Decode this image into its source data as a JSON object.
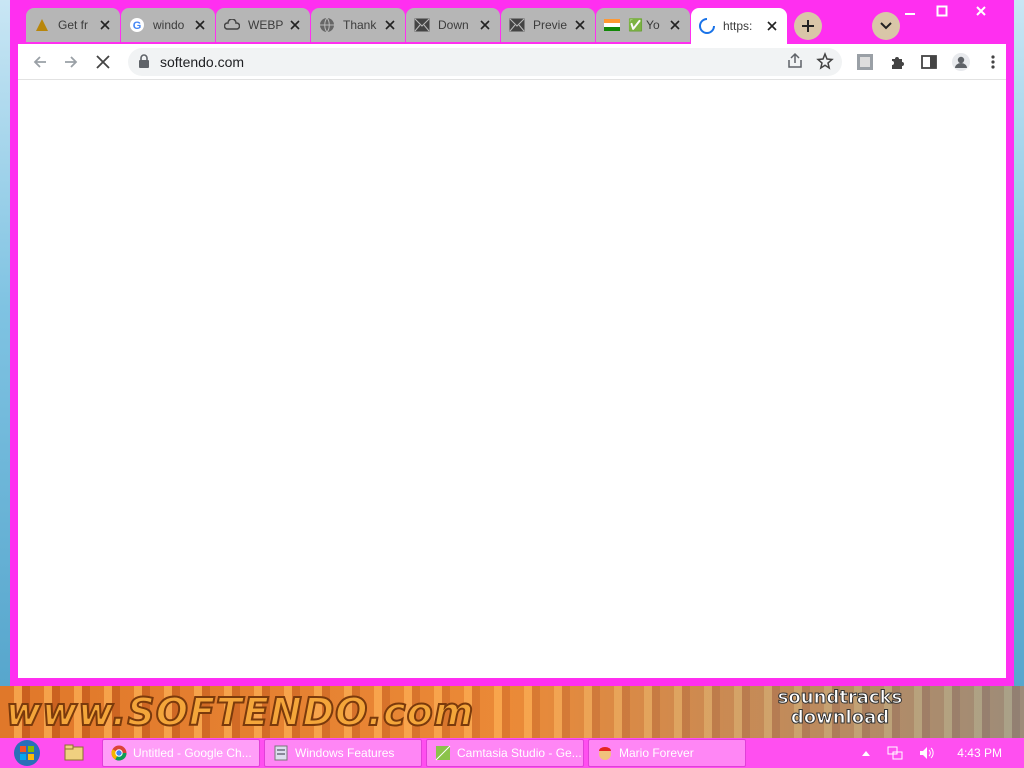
{
  "browser": {
    "tabs": [
      {
        "title": "Get fr",
        "icon": "warning-triangle-icon"
      },
      {
        "title": "windo",
        "icon": "google-icon"
      },
      {
        "title": "WEBP",
        "icon": "cloud-icon"
      },
      {
        "title": "Thank",
        "icon": "globe-icon"
      },
      {
        "title": "Down",
        "icon": "mail-icon"
      },
      {
        "title": "Previe",
        "icon": "mail-icon"
      },
      {
        "title": "✅ Yo",
        "icon": "india-flag-icon"
      },
      {
        "title": "https:",
        "icon": "loading-icon",
        "active": true
      }
    ],
    "url": "softendo.com"
  },
  "banner": {
    "logo_text": "www.SOFTENDO.com",
    "right_line1": "soundtracks",
    "right_line2": "download"
  },
  "taskbar": {
    "items": [
      {
        "label": "Untitled - Google Ch...",
        "icon": "chrome-icon"
      },
      {
        "label": "Windows Features",
        "icon": "windows-features-icon"
      },
      {
        "label": "Camtasia Studio - Ge...",
        "icon": "camtasia-icon"
      },
      {
        "label": "Mario Forever",
        "icon": "mario-icon"
      }
    ],
    "clock": "4:43 PM"
  },
  "colors": {
    "window_frame": "#ff2ff0",
    "taskbar": "#ff4ff0"
  }
}
